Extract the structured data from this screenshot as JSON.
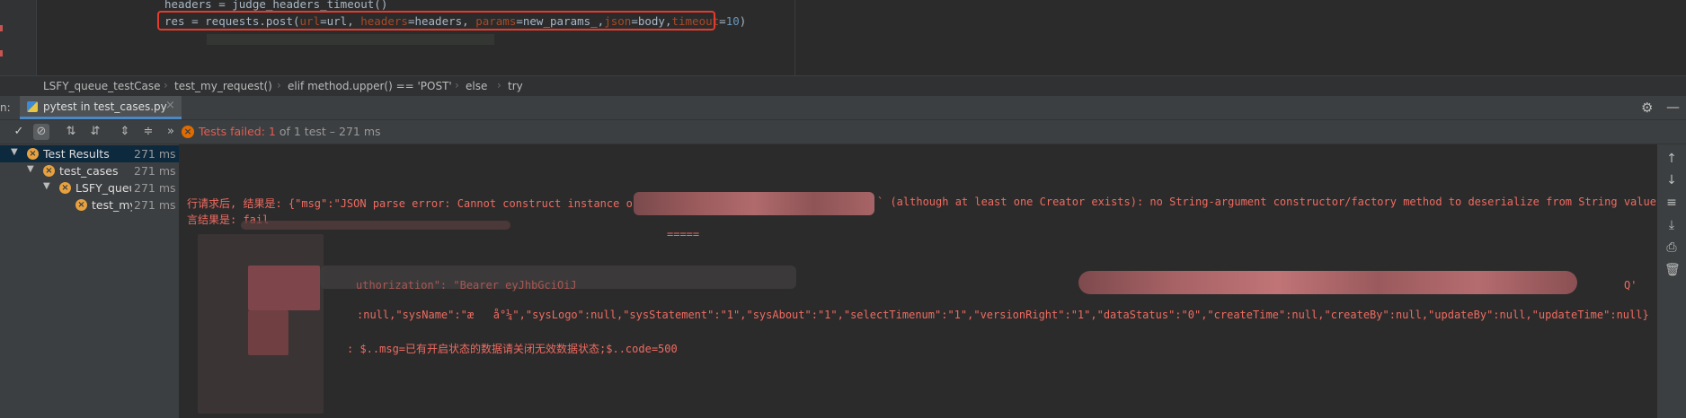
{
  "editor": {
    "lines": [
      {
        "text": "headers = judge_headers_timeout()"
      },
      {
        "prefix": "res = requests.post(",
        "p1": "url",
        "e1": "=url, ",
        "p2": "headers",
        "e2": "=headers, ",
        "p3": "params",
        "e3": "=new_params_,",
        "p4": "json",
        "e4": "=body,",
        "p5": "timeout",
        "e5": "=",
        "num": "10",
        "close": ")"
      }
    ]
  },
  "breadcrumb": [
    "LSFY_queue_testCase",
    "test_my_request()",
    "elif method.upper() == 'POST'",
    "else",
    "try"
  ],
  "run": {
    "label": "n:",
    "tab_title": "pytest in test_cases.py",
    "close_glyph": "×"
  },
  "status": {
    "failed_text": "Tests failed: 1",
    "rest_text": " of 1 test – 271 ms"
  },
  "tree": [
    {
      "label": "Test Results",
      "time": "271 ms"
    },
    {
      "label": "test_cases",
      "time": "271 ms"
    },
    {
      "label": "LSFY_queue",
      "time": "271 ms"
    },
    {
      "label": "test_my",
      "time": "271 ms"
    }
  ],
  "console": {
    "line1_a": "行请求后, 结果是: {\"msg\":\"JSON parse error: Cannot construct instance of",
    "line1_b": "` (although at least one Creator exists): no String-argument constructor/factory method to deserialize from String value ('')",
    "line2": "言结果是: fail",
    "line3": "=====",
    "line4": "uthorization\": \"Bearer eyJhbGciOiJ",
    "line4_end": "Q'",
    "line5": ":null,\"sysName\":\"æ   å°¼\",\"sysLogo\":null,\"sysStatement\":\"1\",\"sysAbout\":\"1\",\"selectTimenum\":\"1\",\"versionRight\":\"1\",\"dataStatus\":\"0\",\"createTime\":null,\"createBy\":null,\"updateBy\":null,\"updateTime\":null}",
    "line6": ": $..msg=已有开启状态的数据请关闭无效数据状态;$..code=500"
  },
  "colors": {
    "error_text": "#ef6b61",
    "highlight_box": "#e53b2c",
    "fail_icon": "#e8a13f"
  }
}
